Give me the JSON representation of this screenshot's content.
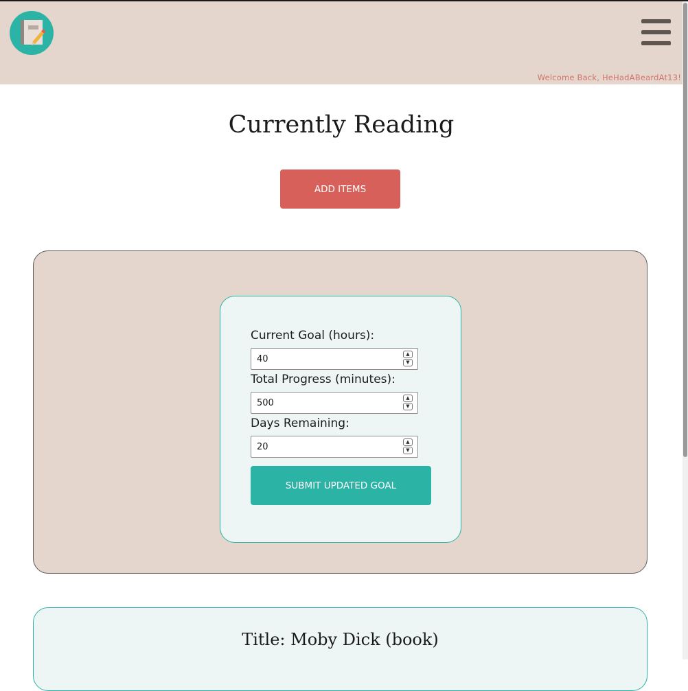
{
  "header": {
    "logo_icon": "notebook-pencil-icon",
    "menu_icon": "hamburger-menu-icon",
    "welcome_text": "Welcome Back, HeHadABeardAt13!"
  },
  "page": {
    "title": "Currently Reading",
    "add_button_label": "ADD ITEMS"
  },
  "goal_form": {
    "goal_label": "Current Goal (hours):",
    "goal_value": "40",
    "progress_label": "Total Progress (minutes):",
    "progress_value": "500",
    "days_label": "Days Remaining:",
    "days_value": "20",
    "submit_label": "SUBMIT UPDATED GOAL"
  },
  "books": [
    {
      "title": "Title: Moby Dick (book)"
    }
  ],
  "colors": {
    "header_bg": "#e4d6cd",
    "accent_teal": "#2bb3a5",
    "accent_red": "#d8605a",
    "card_bg": "#eef6f5"
  }
}
